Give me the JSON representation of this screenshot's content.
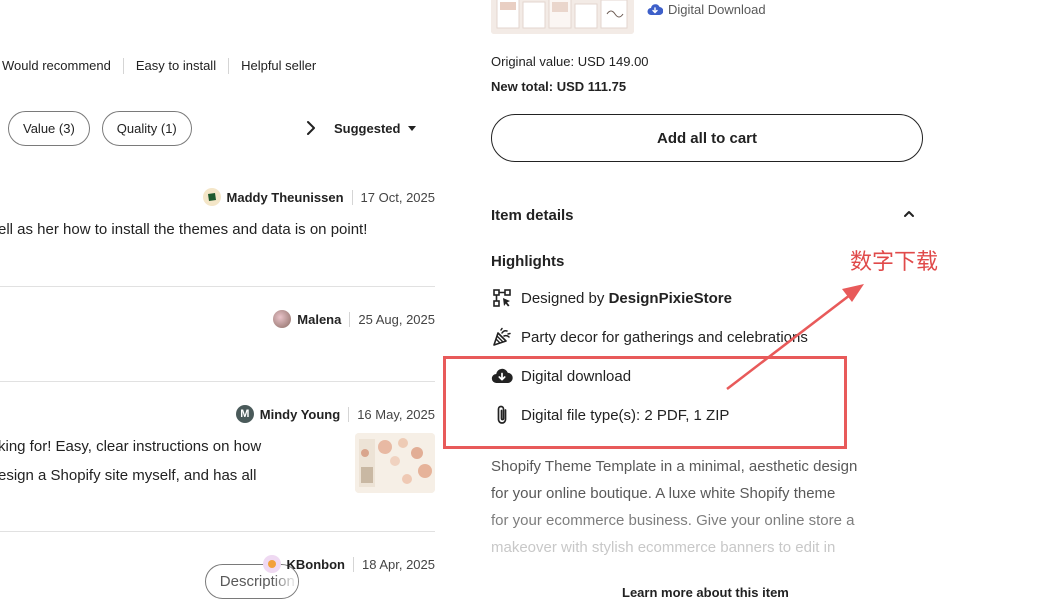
{
  "review_tags": [
    "Would recommend",
    "Easy to install",
    "Helpful seller"
  ],
  "filters": {
    "pills": [
      "Value (3)",
      "Quality (1)",
      "Description"
    ],
    "sort_label": "Suggested"
  },
  "reviews": [
    {
      "name": "Maddy Theunissen",
      "date": "17 Oct, 2025",
      "lines": [
        "ell as her how to install the themes and data is on point!"
      ]
    },
    {
      "name": "Malena",
      "date": "25 Aug, 2025",
      "lines": []
    },
    {
      "name": "Mindy Young",
      "avatar_initial": "M",
      "date": "16 May, 2025",
      "lines": [
        "king for! Easy, clear instructions on how",
        "esign a Shopify site myself, and has all"
      ]
    },
    {
      "name": "KBonbon",
      "date": "18 Apr, 2025",
      "lines": []
    }
  ],
  "bundle": {
    "download_tag": "Digital Download",
    "original_value": "Original value: USD 149.00",
    "new_total": "New total: USD 111.75",
    "add_to_cart": "Add all to cart"
  },
  "item_details": {
    "title": "Item details",
    "highlights_title": "Highlights",
    "designed_by_prefix": "Designed by ",
    "designer": "DesignPixieStore",
    "highlights": [
      {
        "icon": "party-popper-icon",
        "text": "Party decor for gatherings and celebrations"
      },
      {
        "icon": "cloud-download-icon",
        "text": "Digital download"
      },
      {
        "icon": "paperclip-icon",
        "text": "Digital file type(s): 2 PDF, 1 ZIP"
      }
    ],
    "description_lines": [
      "Shopify Theme Template in a minimal, aesthetic design",
      "for your online boutique. A luxe white Shopify theme",
      "for your ecommerce business. Give your online store a",
      "makeover with stylish ecommerce banners to edit in"
    ],
    "learn_more": "Learn more about this item"
  },
  "annotation": {
    "label": "数字下载",
    "color": "#e85a5a"
  }
}
